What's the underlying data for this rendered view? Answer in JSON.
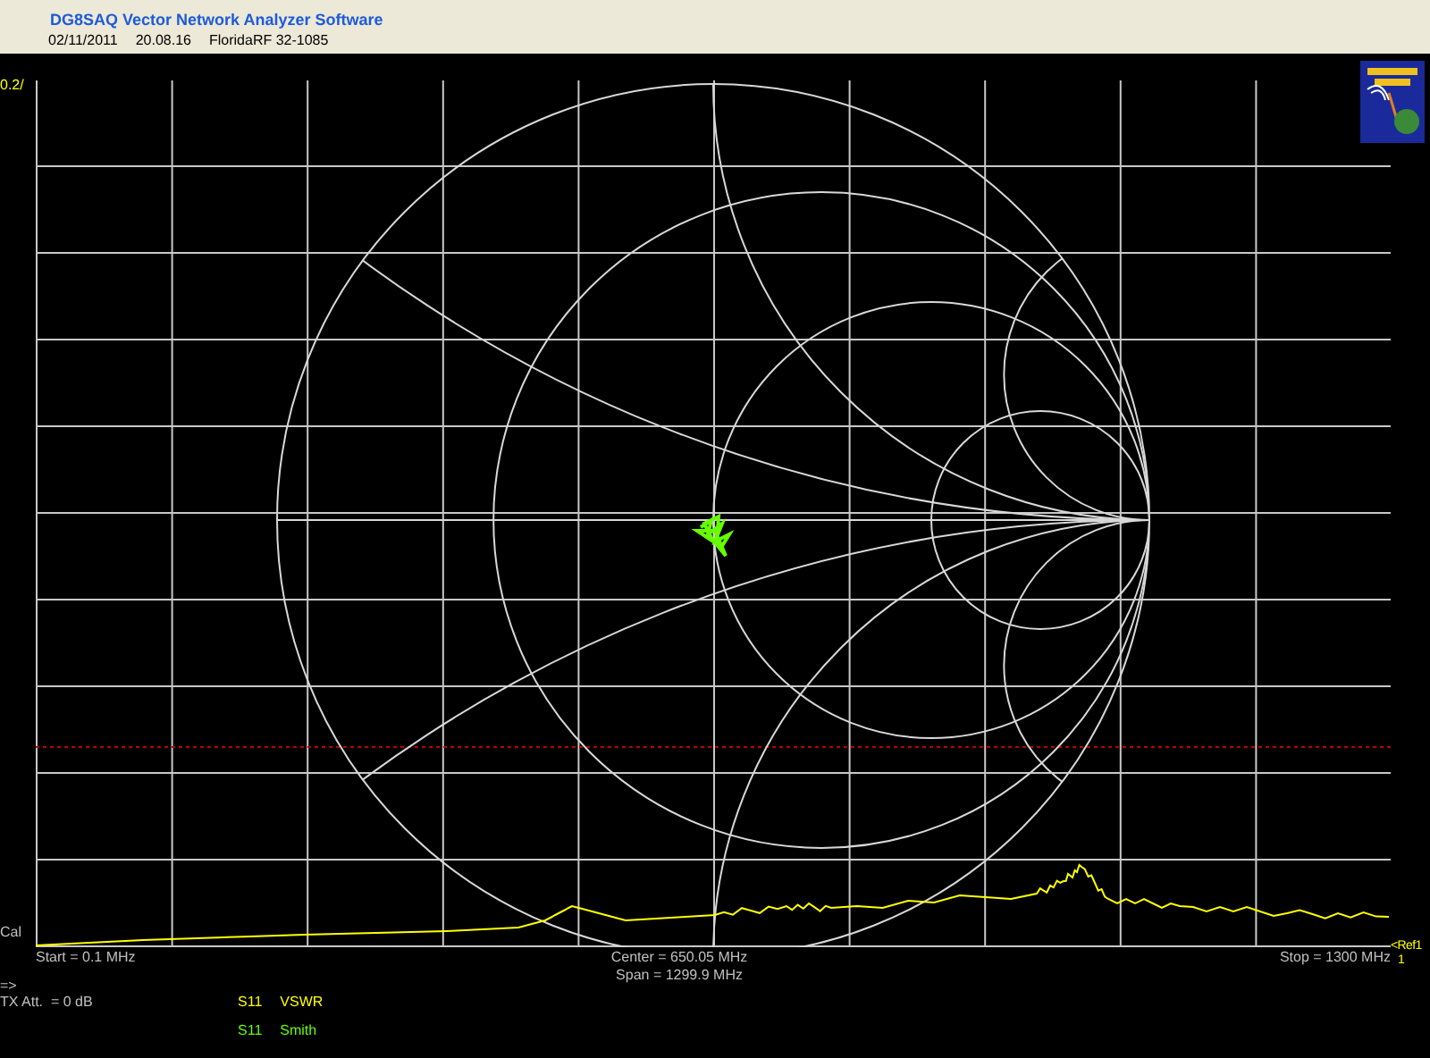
{
  "window": {
    "title": "DG8SAQ Vector Network Analyzer Software",
    "date": "02/11/2011",
    "time": "20.08.16",
    "device": "FloridaRF 32-1085"
  },
  "plot": {
    "scale_label": "0.2/",
    "cal_label": "Cal",
    "ref_label": "<Ref1",
    "ref_index": "1",
    "start": "Start = 0.1 MHz",
    "center": "Center = 650.05 MHz",
    "span": "Span = 1299.9 MHz",
    "stop": "Stop = 1300 MHz"
  },
  "status": {
    "arrow": "=>",
    "tx_att": "TX Att.  = 0 dB"
  },
  "legend": [
    {
      "param": "S11",
      "format": "VSWR",
      "color": "#ffff00"
    },
    {
      "param": "S11",
      "format": "Smith",
      "color": "#66ff00"
    }
  ]
}
